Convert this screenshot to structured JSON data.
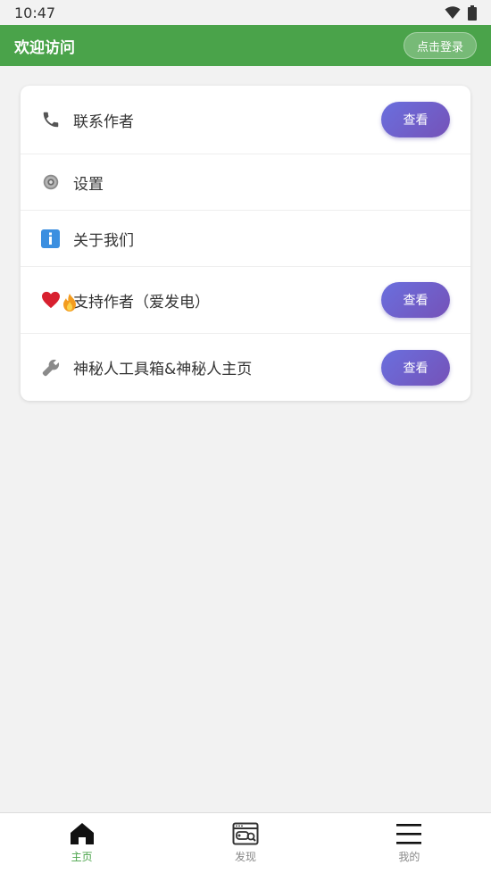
{
  "status": {
    "time": "10:47"
  },
  "appbar": {
    "title": "欢迎访问",
    "login_label": "点击登录"
  },
  "menu": [
    {
      "icon": "phone-icon",
      "label": "联系作者",
      "button": "查看"
    },
    {
      "icon": "gear-icon",
      "label": "设置"
    },
    {
      "icon": "info-icon",
      "label": "关于我们"
    },
    {
      "icon": "heart-fire-icon",
      "label": "支持作者（爱发电）",
      "button": "查看"
    },
    {
      "icon": "wrench-icon",
      "label": "神秘人工具箱&神秘人主页",
      "button": "查看"
    }
  ],
  "nav": [
    {
      "icon": "home-icon",
      "label": "主页",
      "active": true
    },
    {
      "icon": "browser-game-icon",
      "label": "发现"
    },
    {
      "icon": "menu-icon",
      "label": "我的"
    }
  ],
  "colors": {
    "accent": "#4aa34a",
    "button_start": "#6a6fde",
    "button_end": "#7552b8"
  }
}
